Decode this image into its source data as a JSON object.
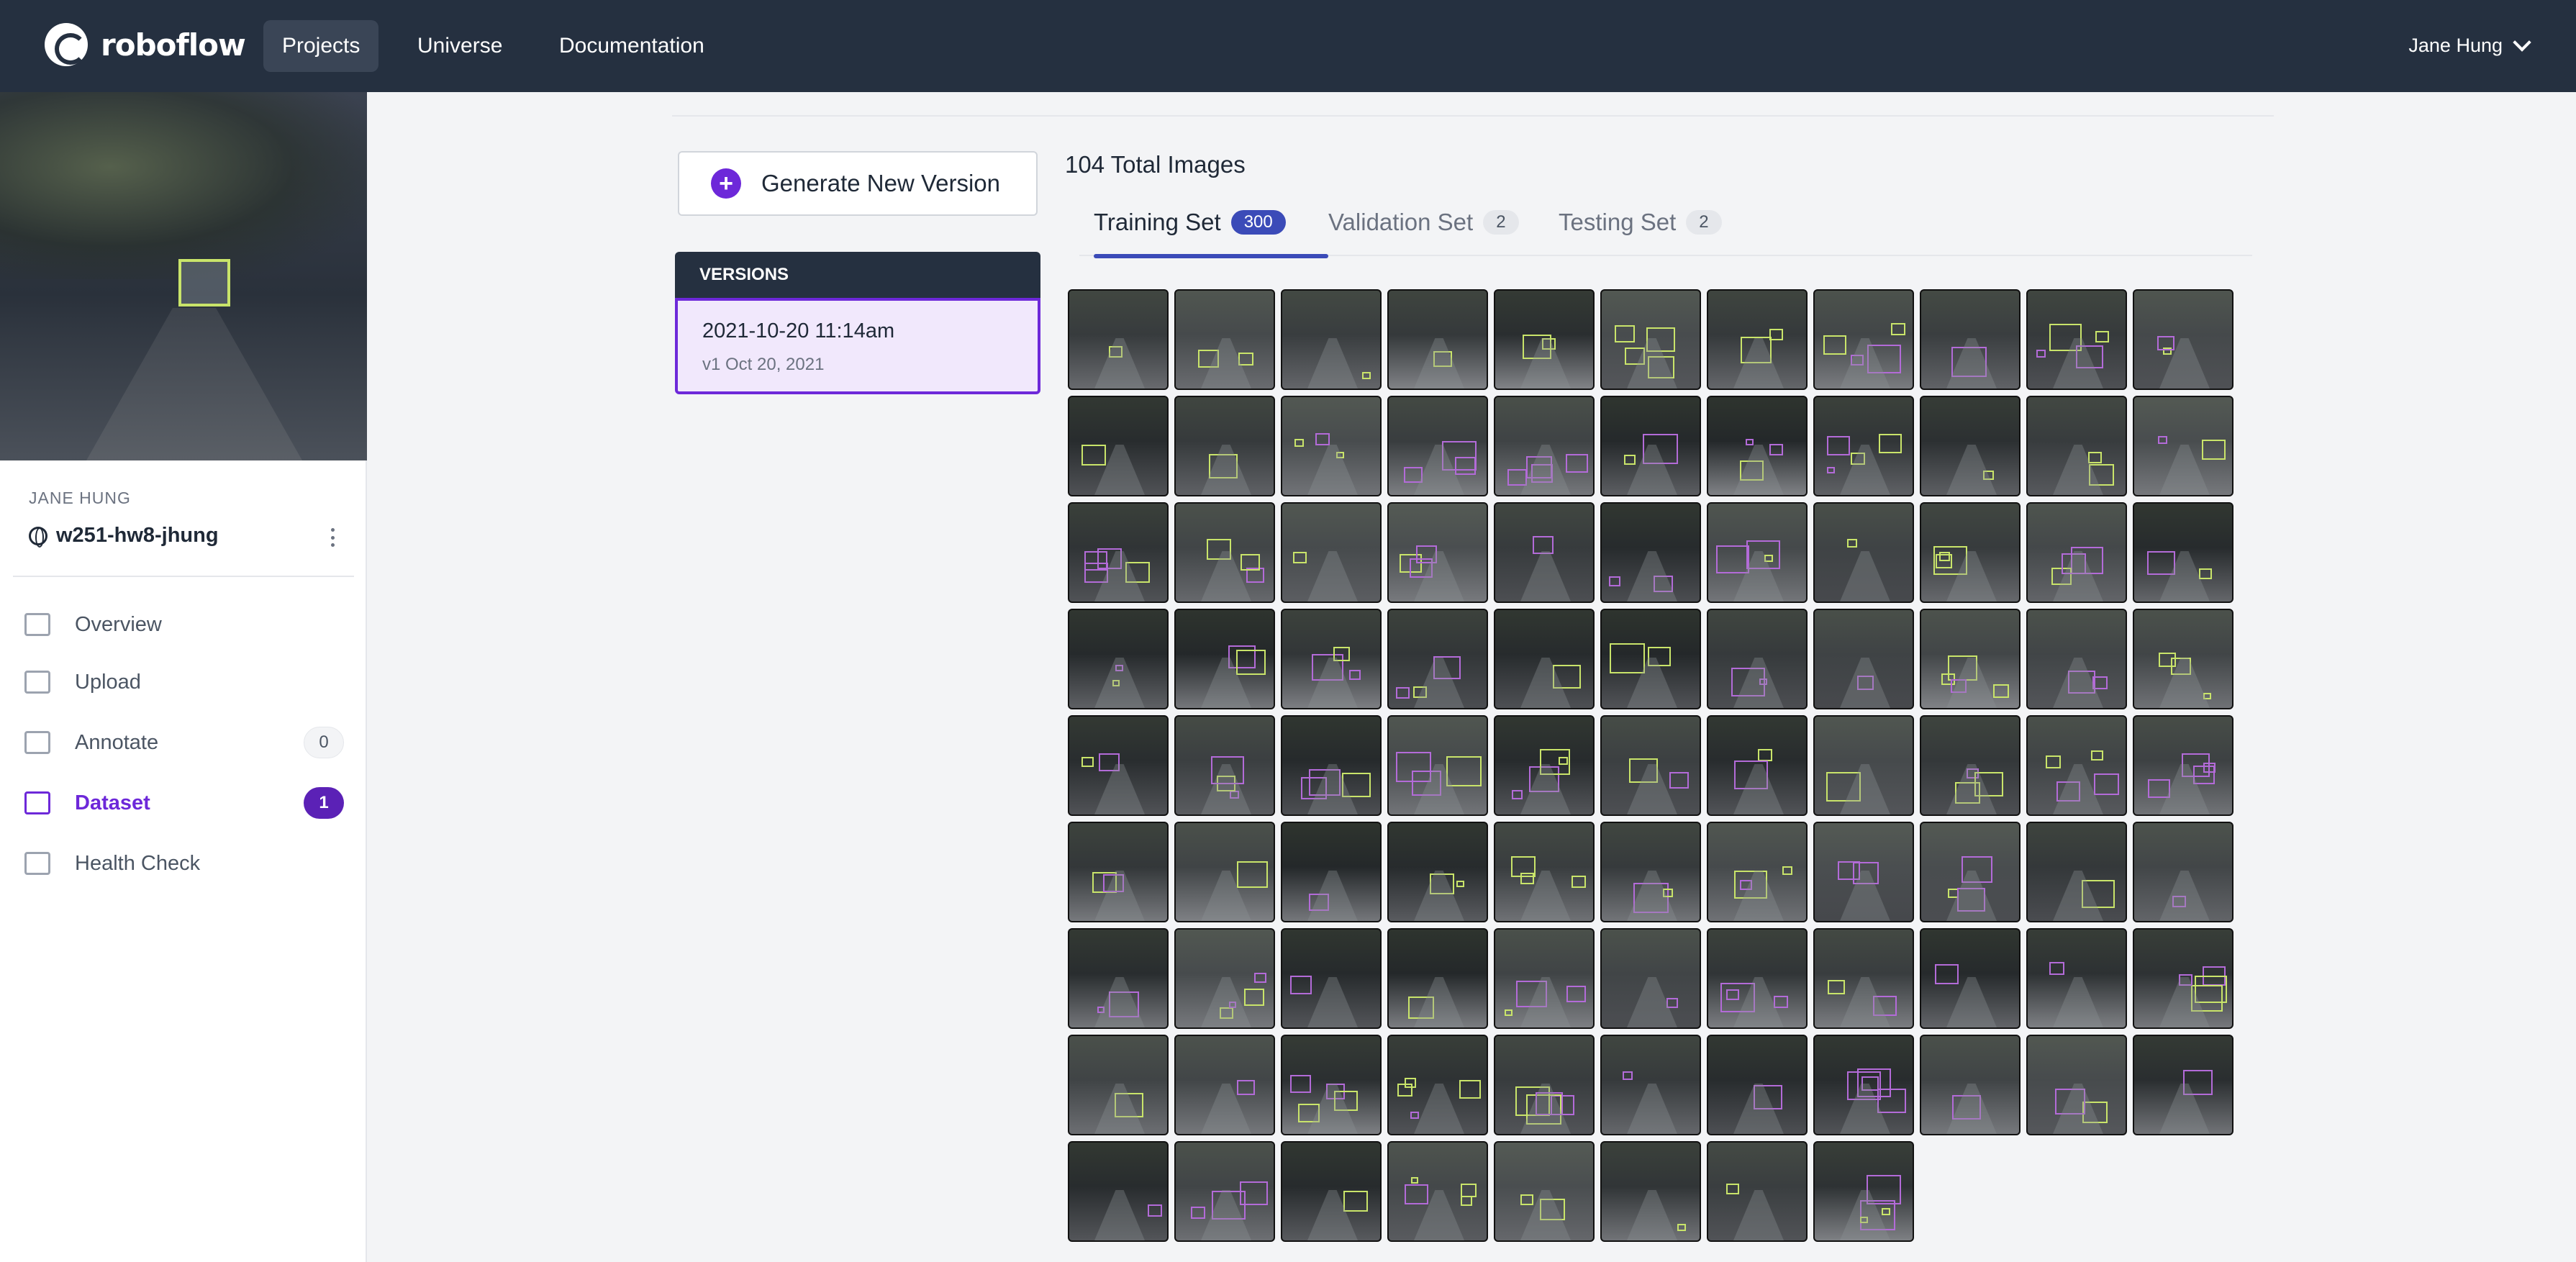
{
  "nav": {
    "logo_text": "roboflow",
    "items": [
      {
        "label": "Projects",
        "active": true
      },
      {
        "label": "Universe",
        "active": false
      },
      {
        "label": "Documentation",
        "active": false
      }
    ],
    "user_name": "Jane Hung"
  },
  "sidebar": {
    "owner": "JANE HUNG",
    "project_name": "w251-hw8-jhung",
    "items": [
      {
        "label": "Overview",
        "icon": "overview-icon"
      },
      {
        "label": "Upload",
        "icon": "upload-icon"
      },
      {
        "label": "Annotate",
        "icon": "annotate-icon",
        "badge": "0"
      },
      {
        "label": "Dataset",
        "icon": "dataset-icon",
        "badge": "1",
        "active": true
      },
      {
        "label": "Health Check",
        "icon": "health-check-icon"
      }
    ]
  },
  "main": {
    "generate_button": "Generate New Version",
    "versions_header": "VERSIONS",
    "version": {
      "title": "2021-10-20 11:14am",
      "subtitle": "v1 Oct 20, 2021"
    },
    "total_images": "104 Total Images",
    "tabs": [
      {
        "label": "Training Set",
        "count": "300",
        "active": true
      },
      {
        "label": "Validation Set",
        "count": "2"
      },
      {
        "label": "Testing Set",
        "count": "2"
      }
    ],
    "thumbnail_count": 96
  },
  "colors": {
    "navbar": "#253040",
    "accent_purple": "#6d28d9",
    "tab_accent": "#3b4bb8",
    "box_green": "#c9e46a",
    "box_purple": "#b36bd8"
  }
}
